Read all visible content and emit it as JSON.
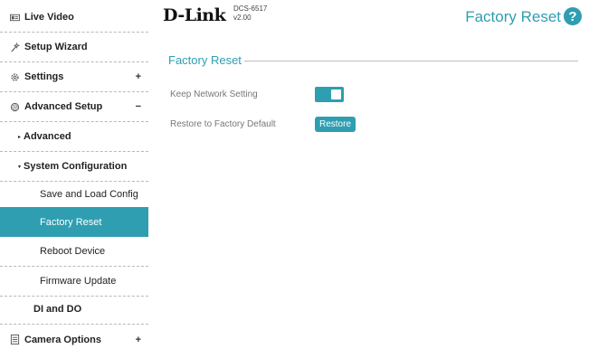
{
  "header": {
    "brand": "D-Link",
    "model": "DCS-6517",
    "version": "v2.00",
    "page_title": "Factory Reset",
    "help_symbol": "?"
  },
  "sidebar": {
    "items": [
      {
        "label": "Live Video",
        "icon": "video-icon"
      },
      {
        "label": "Setup Wizard",
        "icon": "wand-icon"
      },
      {
        "label": "Settings",
        "icon": "gear-icon",
        "toggle": "+"
      },
      {
        "label": "Advanced Setup",
        "icon": "gear-advanced-icon",
        "toggle": "−"
      },
      {
        "label": "Advanced",
        "caret": "▸"
      },
      {
        "label": "System Configuration",
        "caret": "▾"
      },
      {
        "label": "Save and Load Config"
      },
      {
        "label": "Factory Reset",
        "active": true
      },
      {
        "label": "Reboot Device"
      },
      {
        "label": "Firmware Update"
      },
      {
        "label": "DI and DO"
      },
      {
        "label": "Camera Options",
        "icon": "document-icon",
        "toggle": "+"
      }
    ]
  },
  "main": {
    "section_title": "Factory Reset",
    "keep_network_label": "Keep Network Setting",
    "keep_network_value": true,
    "restore_label": "Restore to Factory Default",
    "restore_button": "Restore"
  },
  "colors": {
    "accent": "#2f9eb1"
  }
}
